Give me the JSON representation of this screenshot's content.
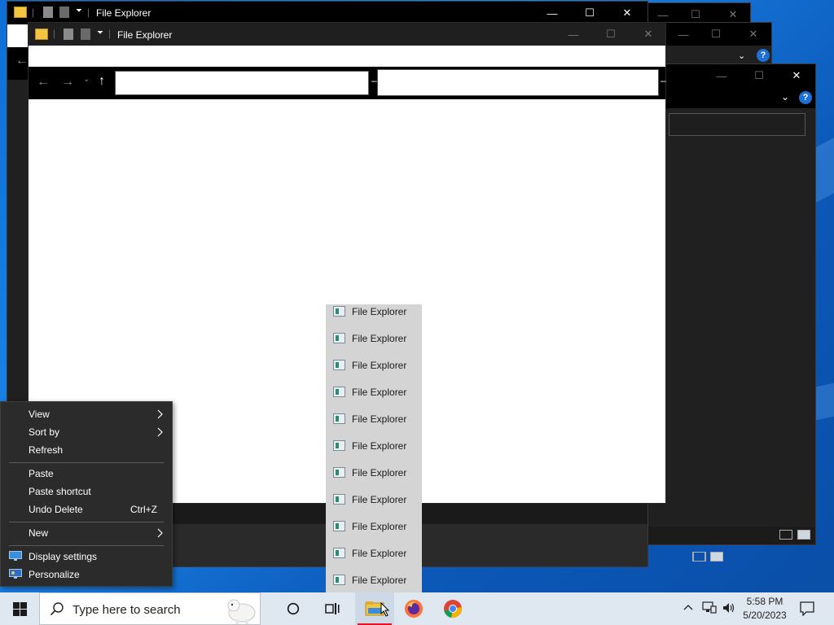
{
  "windows": {
    "app_title": "File Explorer"
  },
  "context_menu": {
    "items": [
      {
        "label": "View",
        "submenu": true
      },
      {
        "label": "Sort by",
        "submenu": true
      },
      {
        "label": "Refresh"
      },
      {
        "label": "Paste"
      },
      {
        "label": "Paste shortcut"
      },
      {
        "label": "Undo Delete",
        "shortcut": "Ctrl+Z"
      },
      {
        "label": "New",
        "submenu": true
      },
      {
        "label": "Display settings",
        "icon": "display-icon"
      },
      {
        "label": "Personalize",
        "icon": "personalize-icon"
      }
    ]
  },
  "jump_list": {
    "items": [
      "File Explorer",
      "File Explorer",
      "File Explorer",
      "File Explorer",
      "File Explorer",
      "File Explorer",
      "File Explorer",
      "File Explorer",
      "File Explorer",
      "File Explorer",
      "File Explorer"
    ]
  },
  "taskbar": {
    "search_placeholder": "Type here to search",
    "apps": [
      "task-view-icon",
      "file-explorer-icon",
      "firefox-icon",
      "chrome-icon"
    ],
    "clock_time": "5:58 PM",
    "clock_date": "5/20/2023"
  },
  "colors": {
    "accent_blue": "#0a64c8",
    "menu_bg": "#2b2b2b",
    "titlebar_bg": "#000000",
    "taskbar_bg": "#dfe7f1",
    "active_app_underline": "#e81123"
  }
}
